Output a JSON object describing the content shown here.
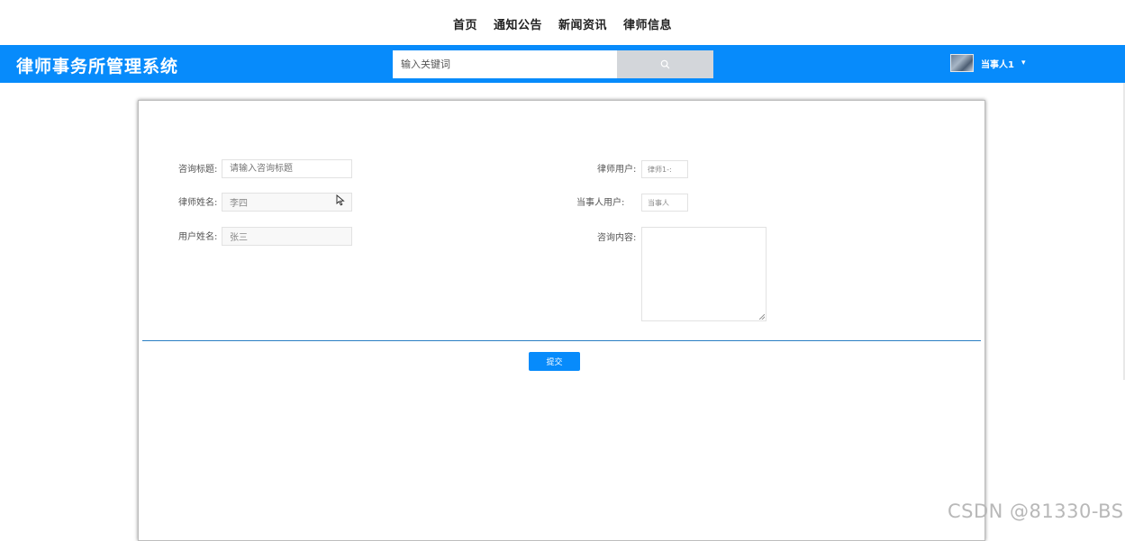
{
  "topnav": {
    "items": [
      "首页",
      "通知公告",
      "新闻资讯",
      "律师信息"
    ]
  },
  "header": {
    "title": "律师事务所管理系统",
    "search_placeholder": "输入关键词",
    "search_icon": "search-icon",
    "user_name": "当事人1",
    "caret": "▾",
    "accent_color": "#078bfb"
  },
  "form": {
    "title_label": "咨询标题:",
    "title_placeholder": "请输入咨询标题",
    "lawyer_name_label": "律师姓名:",
    "lawyer_name_value": "李四",
    "user_name_label": "用户姓名:",
    "user_name_value": "张三",
    "lawyer_user_label": "律师用户:",
    "lawyer_user_value": "律师1-:",
    "client_user_label": "当事人用户:",
    "client_user_value": "当事人",
    "content_label": "咨询内容:",
    "submit_label": "提交"
  },
  "watermark": "CSDN @81330-BS"
}
